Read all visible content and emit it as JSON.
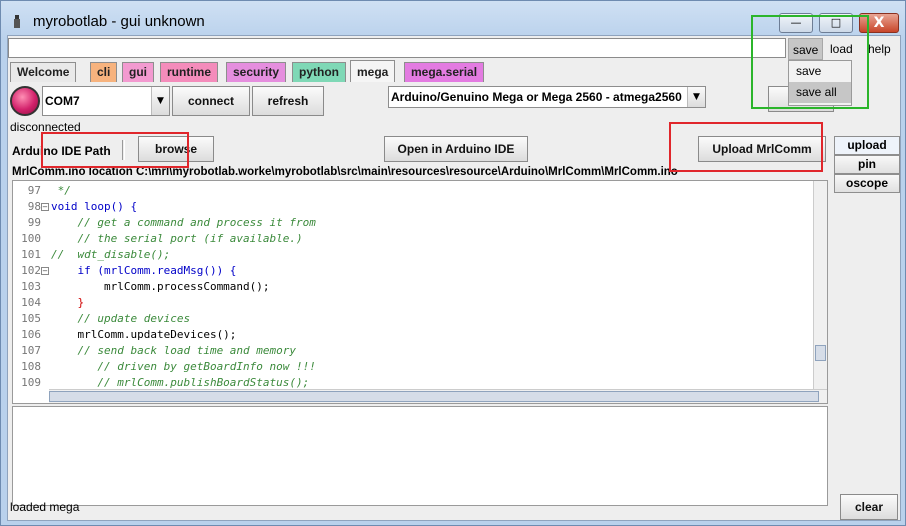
{
  "window": {
    "title": "myrobotlab - gui unknown",
    "min": "—",
    "max": "□",
    "close": "X"
  },
  "menu": {
    "save": "save",
    "load": "load",
    "help": "help",
    "dropdown": [
      "save",
      "save all"
    ]
  },
  "tabs": [
    {
      "label": "Welcome",
      "color": "#e9e9e9"
    },
    {
      "label": "cli",
      "color": "#f7b37e"
    },
    {
      "label": "gui",
      "color": "#f39ad0"
    },
    {
      "label": "runtime",
      "color": "#f48cbb"
    },
    {
      "label": "security",
      "color": "#e58ede"
    },
    {
      "label": "python",
      "color": "#7fd8b6"
    },
    {
      "label": "mega",
      "color": "#f5f5f5"
    },
    {
      "label": "mega.serial",
      "color": "#e37be1"
    }
  ],
  "serial": {
    "port": "COM7",
    "connect": "connect",
    "refresh": "refresh",
    "status": "disconnected"
  },
  "board": {
    "selected": "Arduino/Genuino Mega or Mega 2560 - atmega2560",
    "side_button": "v"
  },
  "ide": {
    "path_label": "Arduino IDE Path",
    "browse": "browse",
    "open": "Open in Arduino IDE",
    "upload": "Upload MrlComm",
    "location": "MrlComm.ino location C:\\mrl\\myrobotlab.worke\\myrobotlab\\src\\main\\resources\\resource\\Arduino\\MrlComm\\MrlComm.ino"
  },
  "code": {
    "lines": [
      {
        "n": "97",
        "t": " */"
      },
      {
        "n": "98",
        "t": "void loop() {"
      },
      {
        "n": "99",
        "t": "    // get a command and process it from"
      },
      {
        "n": "100",
        "t": "    // the serial port (if available.)"
      },
      {
        "n": "101",
        "t": "//  wdt_disable();"
      },
      {
        "n": "102",
        "t": "    if (mrlComm.readMsg()) {"
      },
      {
        "n": "103",
        "t": "        mrlComm.processCommand();"
      },
      {
        "n": "104",
        "t": "    }"
      },
      {
        "n": "105",
        "t": "    // update devices"
      },
      {
        "n": "106",
        "t": "    mrlComm.updateDevices();"
      },
      {
        "n": "107",
        "t": "    // send back load time and memory"
      },
      {
        "n": "108",
        "t": "       // driven by getBoardInfo now !!!"
      },
      {
        "n": "109",
        "t": "       // mrlComm.publishBoardStatus();"
      }
    ]
  },
  "side_tabs": [
    "upload",
    "pin",
    "oscope"
  ],
  "status": {
    "text": "loaded mega",
    "clear": "clear"
  }
}
